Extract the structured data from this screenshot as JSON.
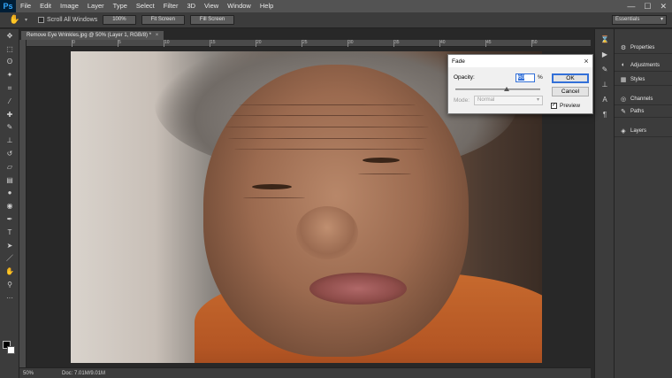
{
  "app": {
    "logo": "Ps"
  },
  "menu": [
    "File",
    "Edit",
    "Image",
    "Layer",
    "Type",
    "Select",
    "Filter",
    "3D",
    "View",
    "Window",
    "Help"
  ],
  "window_controls": {
    "minimize": "—",
    "maximize": "☐",
    "close": "✕"
  },
  "options_bar": {
    "scroll_all_label": "Scroll All Windows",
    "btn_100": "100%",
    "btn_fit": "Fit Screen",
    "btn_fill": "Fill Screen",
    "workspace": "Essentials"
  },
  "document": {
    "tab_title": "Remove Eye Wrinkles.jpg @ 50% (Layer 1, RGB/8) *",
    "close": "×"
  },
  "ruler_ticks": [
    "0",
    "5",
    "10",
    "15",
    "20",
    "25",
    "30",
    "35",
    "40",
    "45",
    "50"
  ],
  "status": {
    "zoom": "50%",
    "doc": "Doc: 7.01M/9.01M"
  },
  "panels": [
    {
      "label": "Properties",
      "icon": "properties-icon",
      "glyph": "⚙"
    },
    {
      "label": "Adjustments",
      "icon": "adjustments-icon",
      "glyph": "◐"
    },
    {
      "label": "Styles",
      "icon": "styles-icon",
      "glyph": "▦"
    },
    {
      "label": "Channels",
      "icon": "channels-icon",
      "glyph": "◎"
    },
    {
      "label": "Paths",
      "icon": "paths-icon",
      "glyph": "✎"
    },
    {
      "label": "Layers",
      "icon": "layers-icon",
      "glyph": "◈"
    }
  ],
  "fade_dialog": {
    "title": "Fade",
    "close": "×",
    "opacity_label": "Opacity:",
    "opacity_value": "60",
    "opacity_unit": "%",
    "opacity_fraction": 0.6,
    "mode_label": "Mode:",
    "mode_value": "Normal",
    "ok_label": "OK",
    "cancel_label": "Cancel",
    "preview_label": "Preview",
    "preview_checked": true
  }
}
